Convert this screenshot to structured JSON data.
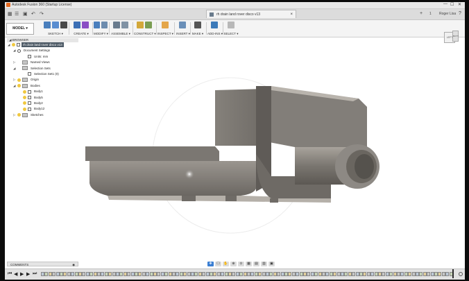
{
  "window": {
    "title": "Autodesk Fusion 360 (Startup License)",
    "controls": [
      "—",
      "☐",
      "✕"
    ]
  },
  "document": {
    "tab_title": "rh drain land rover disco v13"
  },
  "quickbar": {
    "right": {
      "plus": "+",
      "count": "1",
      "user": "Roger Lisa",
      "help": "?"
    }
  },
  "toolbar": {
    "workspace": "MODEL ▾",
    "groups": [
      {
        "id": "sketch",
        "label": "SKETCH ▾",
        "colors": [
          "#4a7fbd",
          "#5a8dd0",
          "#4a4a4a"
        ]
      },
      {
        "id": "create",
        "label": "CREATE ▾",
        "colors": [
          "#3b6fb5",
          "#8a4fc4"
        ]
      },
      {
        "id": "modify",
        "label": "MODIFY ▾",
        "colors": [
          "#4a7fbd",
          "#6d8cae"
        ]
      },
      {
        "id": "assemble",
        "label": "ASSEMBLE ▾",
        "colors": [
          "#6a7c8e",
          "#8092a4"
        ]
      },
      {
        "id": "construct",
        "label": "CONSTRUCT ▾",
        "colors": [
          "#d3a83a",
          "#7a9d52"
        ]
      },
      {
        "id": "inspect",
        "label": "INSPECT ▾",
        "colors": [
          "#e4a64a"
        ]
      },
      {
        "id": "insert",
        "label": "INSERT ▾",
        "colors": [
          "#6a8fb8"
        ]
      },
      {
        "id": "make",
        "label": "MAKE ▾",
        "colors": [
          "#555555"
        ]
      },
      {
        "id": "addins",
        "label": "ADD-INS ▾",
        "colors": [
          "#3c7ab9"
        ]
      },
      {
        "id": "select",
        "label": "SELECT ▾",
        "colors": [
          "#b8b8b8"
        ]
      }
    ]
  },
  "browser": {
    "header": "BROWSER",
    "items": [
      {
        "label": "rh drain land rover disco v13",
        "icon": "root",
        "arrow": "◢",
        "level": 0,
        "selected": true
      },
      {
        "label": "Document Settings",
        "icon": "gear",
        "arrow": "◢",
        "level": 1
      },
      {
        "label": "Units: mm",
        "icon": "box",
        "arrow": "",
        "level": 2
      },
      {
        "label": "Named Views",
        "icon": "folder",
        "arrow": "▷",
        "level": 1
      },
      {
        "label": "Selection Sets",
        "icon": "folder",
        "arrow": "◢",
        "level": 1
      },
      {
        "label": "Selection Set1 (0)",
        "icon": "box",
        "arrow": "",
        "level": 2
      },
      {
        "label": "Origin",
        "icon": "folder",
        "arrow": "▷",
        "level": 1
      },
      {
        "label": "Bodies",
        "icon": "folder",
        "arrow": "◢",
        "level": 1
      },
      {
        "label": "Body1",
        "icon": "box",
        "arrow": "",
        "level": 2
      },
      {
        "label": "Body5",
        "icon": "box",
        "arrow": "",
        "level": 2
      },
      {
        "label": "Body2",
        "icon": "box",
        "arrow": "",
        "level": 2
      },
      {
        "label": "Body12",
        "icon": "box",
        "arrow": "",
        "level": 2
      },
      {
        "label": "Sketches",
        "icon": "folder",
        "arrow": "▷",
        "level": 1
      }
    ]
  },
  "viewcube": {
    "front": "LEFT",
    "side": "BOTT"
  },
  "comments": {
    "label": "COMMENTS",
    "icon": "◉"
  },
  "navbar": {
    "buttons": [
      "✥",
      "☐",
      "✋",
      "⊕",
      "⊙",
      "▦",
      "▤",
      "▥",
      "▣"
    ]
  },
  "timeline": {
    "controls": [
      "⏮",
      "◀",
      "▶",
      "▶",
      "⏭"
    ],
    "item_count": 110
  },
  "colors": {
    "model_dark": "#6e6a65",
    "model_mid": "#8d8984",
    "model_light": "#b2ada6",
    "accent_blue": "#3b7fd3"
  }
}
